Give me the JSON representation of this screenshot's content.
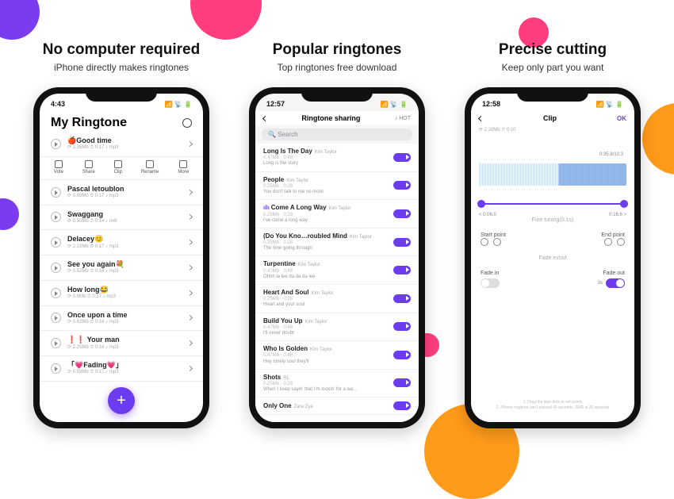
{
  "decor": {},
  "screens": [
    {
      "headline": "No computer required",
      "subtitle": "iPhone directly makes ringtones",
      "phone": {
        "time": "4:43",
        "page_title": "My Ringtone",
        "featured": {
          "title": "🍎Good time",
          "meta": "⟳ 2.35Mb  ⏱ 0:17  ♪ mp3"
        },
        "toolbar": [
          {
            "label": "Vote"
          },
          {
            "label": "Share"
          },
          {
            "label": "Clip"
          },
          {
            "label": "Rename"
          },
          {
            "label": "More"
          }
        ],
        "songs": [
          {
            "title": "Pascal letoublon",
            "meta": "⟳ 0.59Mb  ⏱ 0:17  ♪ mp3"
          },
          {
            "title": "Swaggang",
            "meta": "⟳ 0.50Mb  ⏱ 0:14  ♪ m4r"
          },
          {
            "title": "Delacey😊",
            "meta": "⟳ 2.22Mb  ⏱ 0:17  ♪ mp3"
          },
          {
            "title": "See you again💐",
            "meta": "⟳ 0.52Mb  ⏱ 0:14  ♪ mp3"
          },
          {
            "title": "How long😂",
            "meta": "⟳ 0.6Mb   ⏱ 0:17  ♪ mp3"
          },
          {
            "title": "Once upon a time",
            "meta": "⟳ 0.62Mb  ⏱ 0:14  ♪ mp3"
          },
          {
            "title": "❗❗ Your man",
            "meta": "⟳ 2.20Mb  ⏱ 0:14  ♪ mp3"
          },
          {
            "title": "「💗Fading💗」",
            "meta": "⟳ 0.59Mb  ⏱ 0:17  ♪ mp3"
          }
        ],
        "fab": "+"
      }
    },
    {
      "headline": "Popular ringtones",
      "subtitle": "Top ringtones free download",
      "phone": {
        "time": "12:57",
        "nav_title": "Ringtone sharing",
        "nav_right": "♪ HOT",
        "search_placeholder": "Search",
        "songs": [
          {
            "title": "Long Is The Day",
            "artist": "Kim Taylor",
            "meta": "0.47Mb · 0:48",
            "sub": "Long is the story"
          },
          {
            "title": "People",
            "artist": "Kim Taylor",
            "meta": "0.25Mb · 0:28",
            "sub": "You don't talk to me no more"
          },
          {
            "title": "Come A Long Way",
            "artist": "Kim Taylor",
            "meta": "0.25Mb · 0:29",
            "sub": "I've come a long way",
            "playing": true
          },
          {
            "title": "(Do You Kno…roubled Mind",
            "artist": "Kim Taylor",
            "meta": "0.25Mb · 0:28",
            "sub": "The time going through"
          },
          {
            "title": "Turpentine",
            "artist": "Kim Taylor",
            "meta": "0.47Mb · 0:48",
            "sub": "Ohhh la lee da da da lee"
          },
          {
            "title": "Heart And Soul",
            "artist": "Kim Taylor",
            "meta": "0.25Mb · 0:28",
            "sub": "Heart and your soul"
          },
          {
            "title": "Build You Up",
            "artist": "Kim Taylor",
            "meta": "0.47Mb · 0:48",
            "sub": "I'll never doubt"
          },
          {
            "title": "Who Is Golden",
            "artist": "Kim Taylor",
            "meta": "0.47Mb · 0:48",
            "sub": "Hey lonely soul they'll"
          },
          {
            "title": "Shots",
            "artist": "RL",
            "meta": "0.25Mb · 0:28",
            "sub": "When I keep sayin' that I'm lookin' for a wa…"
          },
          {
            "title": "Only One",
            "artist": "Zara Zya",
            "meta": "",
            "sub": ""
          }
        ]
      }
    },
    {
      "headline": "Precise cutting",
      "subtitle": "Keep only part you want",
      "phone": {
        "time": "12:58",
        "nav_title": "Clip",
        "nav_right": "OK",
        "file_meta": "⟳ 2.28Mb  ⏱ 0:10",
        "range_end_label": "0:35.8/10.3",
        "slider_left": "< 0:06.0",
        "slider_right": "0:16.6 >",
        "fine_label": "Fine tuning(0.1s)",
        "start_label": "Start point",
        "end_label": "End point",
        "fade_section": "Fade in/out",
        "fade_in_label": "Fade in",
        "fade_out_label": "Fade out",
        "fade_out_value": "3s",
        "footer1": "1. Drag the blue dots to set points",
        "footer2": "2. iPhone ringtone can't exceed 40 seconds. SMS is 20 seconds"
      }
    }
  ]
}
